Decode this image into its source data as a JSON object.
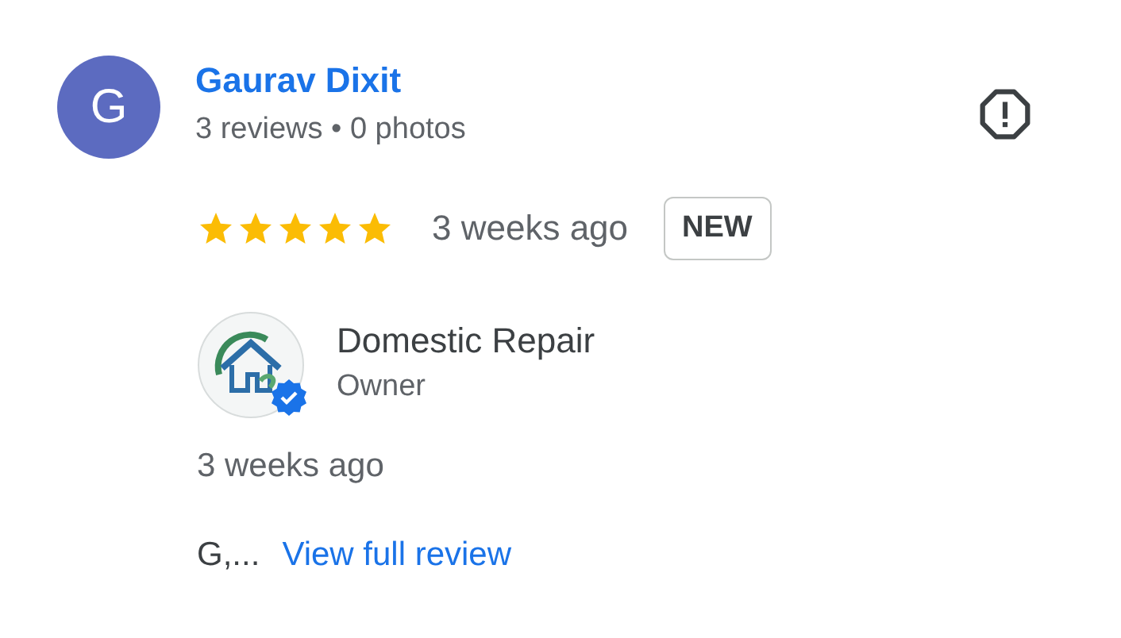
{
  "reviewer": {
    "initial": "G",
    "name": "Gaurav Dixit",
    "stats": "3 reviews • 0 photos"
  },
  "review": {
    "stars": 5,
    "time": "3 weeks ago",
    "badge": "NEW"
  },
  "owner_reply": {
    "name": "Domestic Repair",
    "role": "Owner",
    "verified": true,
    "time": "3 weeks ago",
    "excerpt": "G,...",
    "link": "View full review"
  }
}
